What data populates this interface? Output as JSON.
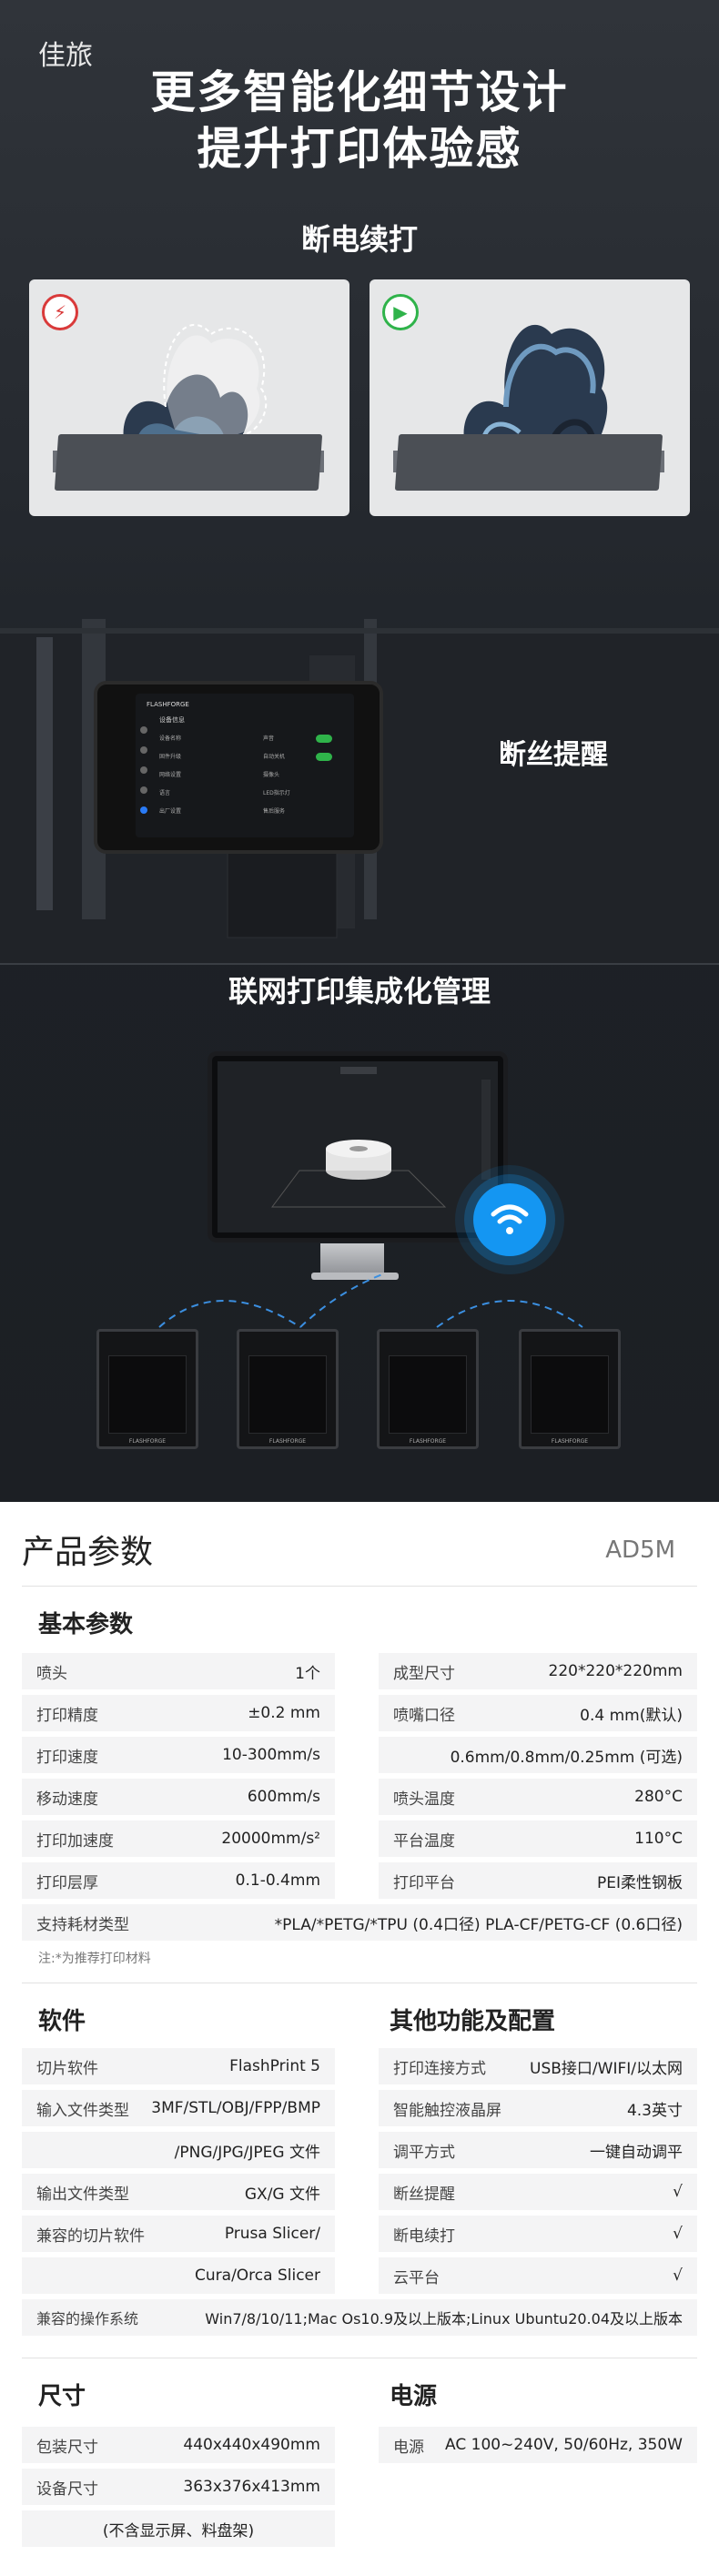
{
  "brand": "佳旅",
  "hero": {
    "line1": "更多智能化细节设计",
    "line2": "提升打印体验感"
  },
  "feature_resume": "断电续打",
  "feature_runout": "断丝提醒",
  "network_title": "联网打印集成化管理",
  "tablet": {
    "brand": "FLASHFORGE",
    "menu_title": "设备信息",
    "left_items": [
      "设备名称",
      "固件升级",
      "网络设置",
      "语言",
      "出厂设置"
    ],
    "right_items": [
      "声音",
      "自动关机",
      "摄像头",
      "LED指示灯",
      "售后服务"
    ]
  },
  "monitor_printer_label": "FLASHFORGE",
  "specs": {
    "title": "产品参数",
    "model": "AD5M",
    "basic": {
      "heading": "基本参数",
      "left": [
        {
          "k": "喷头",
          "v": "1个"
        },
        {
          "k": "打印精度",
          "v": "±0.2 mm"
        },
        {
          "k": "打印速度",
          "v": "10-300mm/s"
        },
        {
          "k": "移动速度",
          "v": "600mm/s"
        },
        {
          "k": "打印加速度",
          "v": "20000mm/s²"
        },
        {
          "k": "打印层厚",
          "v": "0.1-0.4mm"
        }
      ],
      "right": [
        {
          "k": "成型尺寸",
          "v": "220*220*220mm"
        },
        {
          "k": "喷嘴口径",
          "v": "0.4 mm(默认)"
        },
        {
          "k": "",
          "v": "0.6mm/0.8mm/0.25mm (可选)"
        },
        {
          "k": "喷头温度",
          "v": "280°C"
        },
        {
          "k": "平台温度",
          "v": "110°C"
        },
        {
          "k": "打印平台",
          "v": "PEI柔性钢板"
        }
      ],
      "full": {
        "k": "支持耗材类型",
        "v": "*PLA/*PETG/*TPU (0.4口径)  PLA-CF/PETG-CF (0.6口径)"
      },
      "note": "注:*为推荐打印材料"
    },
    "software": {
      "heading": "软件",
      "rows": [
        {
          "k": "切片软件",
          "v": "FlashPrint 5"
        },
        {
          "k": "输入文件类型",
          "v": "3MF/STL/OBJ/FPP/BMP"
        },
        {
          "k": "",
          "v": "/PNG/JPG/JPEG 文件"
        },
        {
          "k": "输出文件类型",
          "v": "GX/G 文件"
        },
        {
          "k": "兼容的切片软件",
          "v": "Prusa Slicer/"
        },
        {
          "k": "",
          "v": "Cura/Orca Slicer"
        }
      ],
      "os": {
        "k": "兼容的操作系统",
        "v": "Win7/8/10/11;Mac Os10.9及以上版本;Linux Ubuntu20.04及以上版本"
      }
    },
    "other": {
      "heading": "其他功能及配置",
      "rows": [
        {
          "k": "打印连接方式",
          "v": "USB接口/WIFI/以太网"
        },
        {
          "k": "智能触控液晶屏",
          "v": "4.3英寸"
        },
        {
          "k": "调平方式",
          "v": "一键自动调平"
        },
        {
          "k": "断丝提醒",
          "v": "√"
        },
        {
          "k": "断电续打",
          "v": "√"
        },
        {
          "k": "云平台",
          "v": "√"
        }
      ]
    },
    "size": {
      "heading": "尺寸",
      "rows": [
        {
          "k": "包装尺寸",
          "v": "440x440x490mm"
        },
        {
          "k": "设备尺寸",
          "v": "363x376x413mm"
        },
        {
          "k": "",
          "v": "(不含显示屏、料盘架)"
        }
      ]
    },
    "power": {
      "heading": "电源",
      "rows": [
        {
          "k": "电源",
          "v": "AC 100~240V, 50/60Hz, 350W"
        }
      ]
    }
  }
}
